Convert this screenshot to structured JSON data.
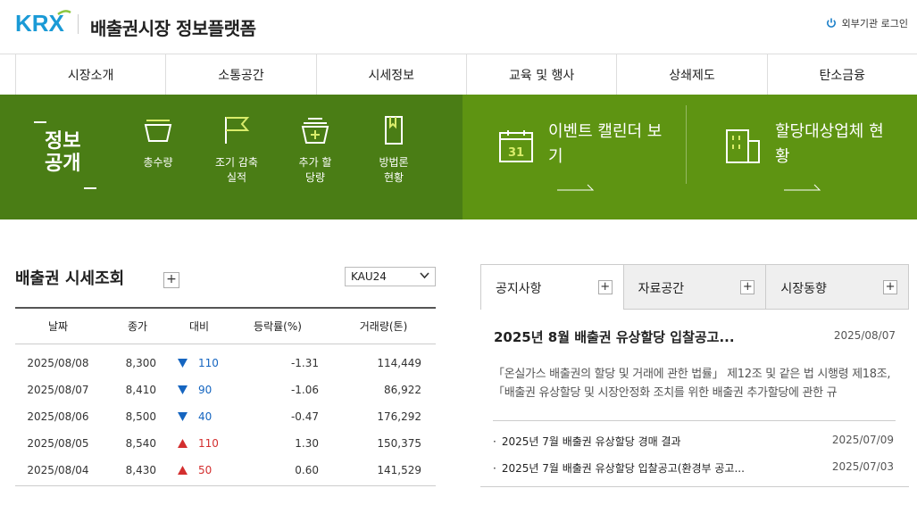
{
  "header": {
    "logo": "KRX",
    "title": "배출권시장 정보플랫폼",
    "login_label": "외부기관 로그인"
  },
  "nav": [
    "시장소개",
    "소통공간",
    "시세정보",
    "교육 및 행사",
    "상쇄제도",
    "탄소금융"
  ],
  "banner": {
    "info_label": "정보 공개",
    "quick_links": [
      {
        "label": "총수량",
        "icon": "basket-icon"
      },
      {
        "label": "조기 감축실적",
        "icon": "flag-icon"
      },
      {
        "label": "추가 할당량",
        "icon": "add-basket-icon"
      },
      {
        "label": "방법론 현황",
        "icon": "book-icon"
      }
    ],
    "calendar_link": "이벤트 캘린더 보기",
    "calendar_day": "31",
    "company_link": "할당대상업체 현황",
    "colors": {
      "left": "#4a7d15",
      "right": "#5e9412",
      "icon": "#c8e34a"
    }
  },
  "price": {
    "title": "배출권 시세조회",
    "selected_product": "KAU24",
    "columns": [
      "날짜",
      "종가",
      "대비",
      "등락률(%)",
      "거래량(톤)"
    ],
    "rows": [
      {
        "date": "2025/08/08",
        "close": "8,300",
        "dir": "down",
        "diff": "110",
        "rate": "-1.31",
        "volume": "114,449"
      },
      {
        "date": "2025/08/07",
        "close": "8,410",
        "dir": "down",
        "diff": "90",
        "rate": "-1.06",
        "volume": "86,922"
      },
      {
        "date": "2025/08/06",
        "close": "8,500",
        "dir": "down",
        "diff": "40",
        "rate": "-0.47",
        "volume": "176,292"
      },
      {
        "date": "2025/08/05",
        "close": "8,540",
        "dir": "up",
        "diff": "110",
        "rate": "1.30",
        "volume": "150,375"
      },
      {
        "date": "2025/08/04",
        "close": "8,430",
        "dir": "up",
        "diff": "50",
        "rate": "0.60",
        "volume": "141,529"
      }
    ]
  },
  "notice": {
    "tabs": [
      "공지사항",
      "자료공간",
      "시장동향"
    ],
    "main_title": "2025년 8월 배출권 유상할당 입찰공고...",
    "main_date": "2025/08/07",
    "main_body": "「온실가스 배출권의 할당 및 거래에 관한 법률」 제12조 및 같은 법 시행령 제18조,「배출권 유상할당 및 시장안정화 조치를 위한 배출권 추가할당에 관한 규",
    "items": [
      {
        "title": "2025년 7월 배출권 유상할당 경매 결과",
        "date": "2025/07/09"
      },
      {
        "title": "2025년 7월 배출권 유상할당 입찰공고(환경부 공고...",
        "date": "2025/07/03"
      }
    ]
  }
}
